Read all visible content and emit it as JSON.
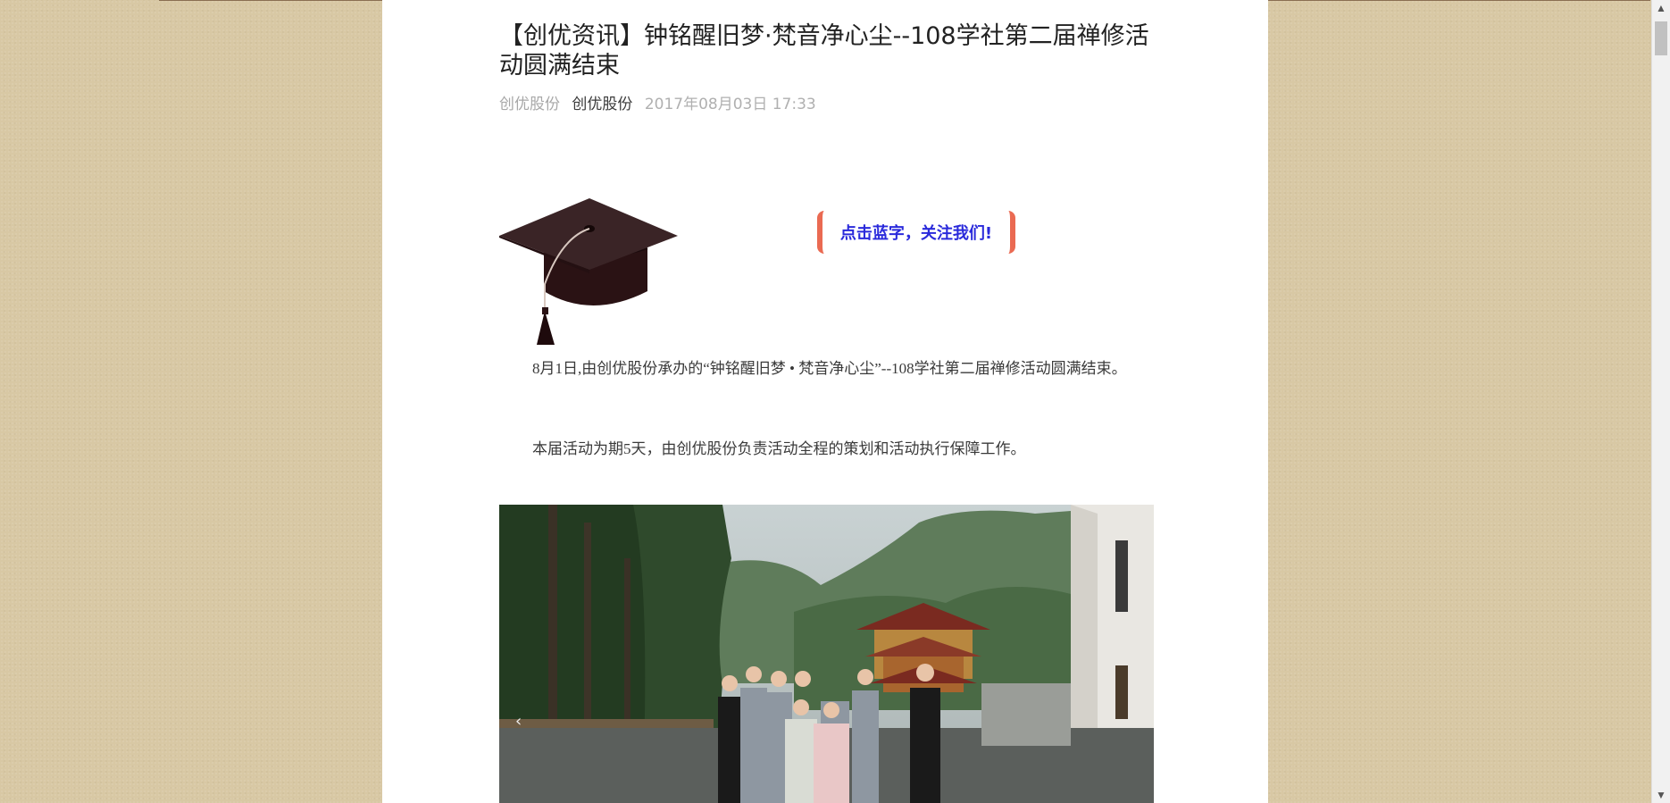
{
  "article": {
    "title": "【创优资讯】钟铭醒旧梦·梵音净心尘--108学社第二届禅修活动圆满结束",
    "meta": {
      "author": "创优股份",
      "account": "创优股份",
      "date": "2017年08月03日 17:33"
    },
    "follow_banner": "点击蓝字，关注我们!",
    "paragraphs": [
      "8月1日,由创优股份承办的“钟铭醒旧梦 • 梵音净心尘”--108学社第二届禅修活动圆满结束。",
      "本届活动为期5天，由创优股份负责活动全程的策划和活动执行保障工作。"
    ]
  },
  "icons": {
    "graduation_cap": "graduation-cap-icon",
    "photo_prev": "chevron-left-icon",
    "scroll_up": "chevron-up-icon",
    "scroll_down": "chevron-down-icon"
  },
  "colors": {
    "background": "#d8c8a4",
    "follow_text": "#2a2adb",
    "follow_border": "#ea6a52"
  }
}
